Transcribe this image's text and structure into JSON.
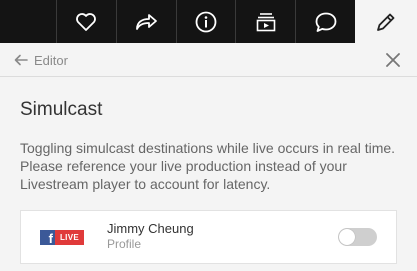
{
  "toolbar": {
    "icons": [
      "heart-icon",
      "share-icon",
      "info-icon",
      "media-library-icon",
      "chat-icon",
      "pencil-icon"
    ],
    "active": "pencil-icon"
  },
  "subheader": {
    "back_label": "Editor"
  },
  "section": {
    "title": "Simulcast",
    "description": "Toggling simulcast destinations while live occurs in real time. Please reference your live production instead of your Livestream player to account for latency."
  },
  "destination": {
    "live_badge": "LIVE",
    "name": "Jimmy Cheung",
    "type": "Profile",
    "enabled": false
  },
  "colors": {
    "toolbar_bg": "#141414",
    "facebook": "#3b5998",
    "live_red": "#e03a3a",
    "toggle_off": "#cfcfcf"
  }
}
